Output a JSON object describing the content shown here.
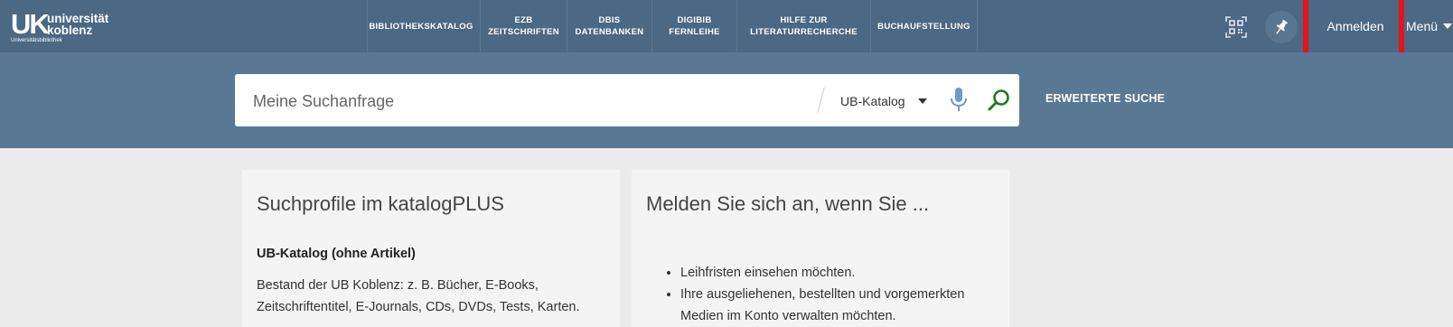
{
  "logo": {
    "mark": "UK",
    "line1": "universität",
    "line2": "koblenz",
    "sub": "Universitätsbibliothek"
  },
  "nav": [
    {
      "line1": "BIBLIOTHEKSKATALOG",
      "line2": ""
    },
    {
      "line1": "EZB",
      "line2": "ZEITSCHRIFTEN"
    },
    {
      "line1": "DBIS",
      "line2": "DATENBANKEN"
    },
    {
      "line1": "DIGIBIB",
      "line2": "FERNLEIHE"
    },
    {
      "line1": "HILFE ZUR",
      "line2": "LITERATURRECHERCHE"
    },
    {
      "line1": "BUCHAUFSTELLUNG",
      "line2": ""
    }
  ],
  "header": {
    "qr_icon": "qr-code-icon",
    "pin_icon": "pin-icon",
    "login_label": "Anmelden",
    "menu_label": "Menü"
  },
  "search": {
    "placeholder": "Meine Suchanfrage",
    "value": "",
    "catalog_selected": "UB-Katalog",
    "advanced_label": "ERWEITERTE SUCHE"
  },
  "colors": {
    "topbar": "#4b6884",
    "searchband": "#587894",
    "highlight": "#e3151a",
    "mic": "#6b9bd1",
    "search": "#1f7a1f"
  },
  "cards": {
    "profiles": {
      "title": "Suchprofile im katalogPLUS",
      "item_title": "UB-Katalog (ohne Artikel)",
      "item_desc": "Bestand der UB Koblenz: z. B. Bücher, E-Books, Zeitschriftentitel, E-Journals, CDs, DVDs, Tests, Karten."
    },
    "login": {
      "title": "Melden Sie sich an, wenn Sie ...",
      "bullets": [
        "Leihfristen einsehen möchten.",
        "Ihre ausgeliehenen, bestellten und vorgemerkten Medien im Konto verwalten möchten."
      ]
    }
  }
}
